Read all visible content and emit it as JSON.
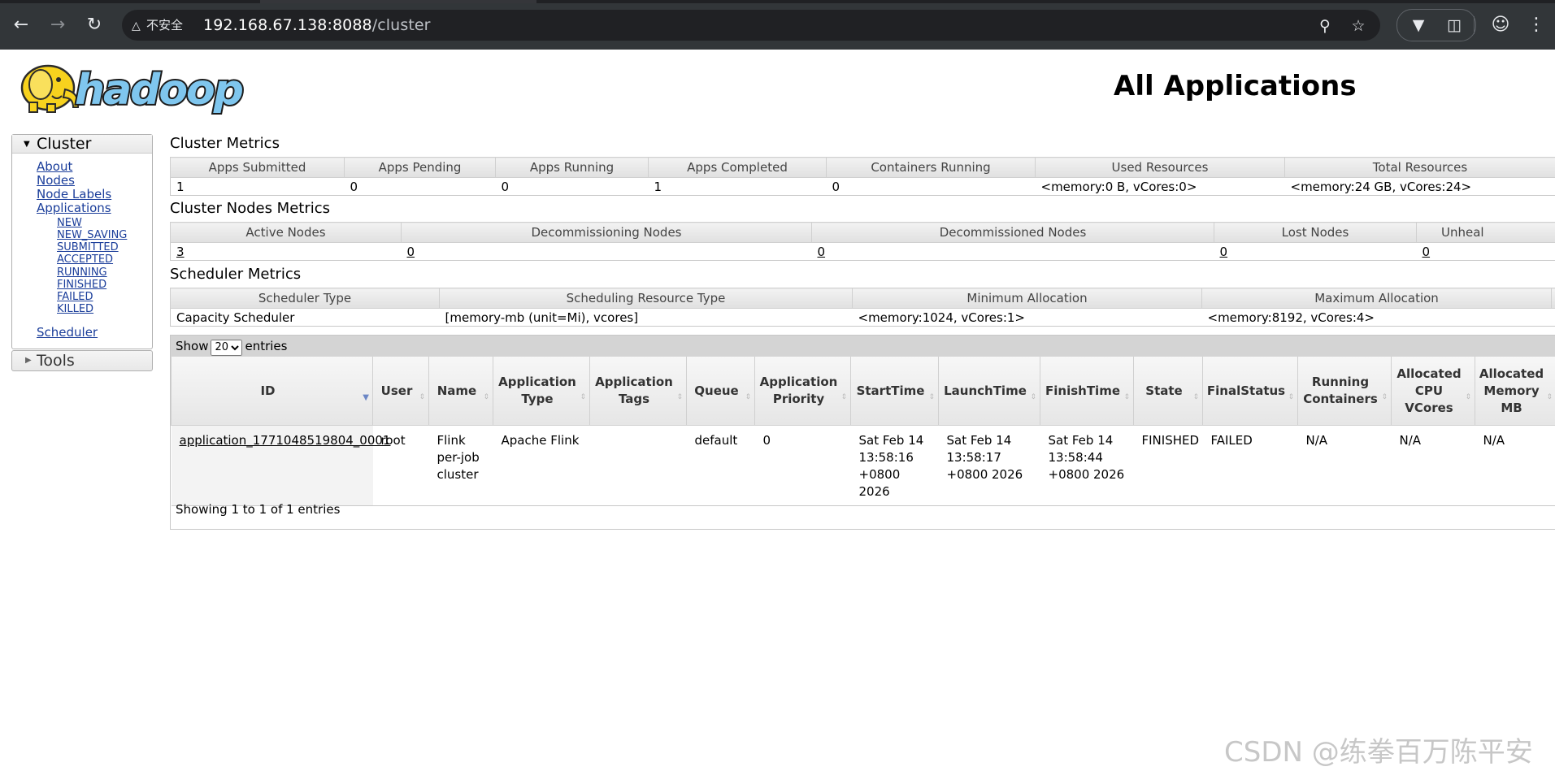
{
  "browser": {
    "security_label": "不安全",
    "url_host": "192.168.67.138:8088",
    "url_path": "/cluster",
    "icons": [
      "back-icon",
      "forward-icon",
      "reload-icon",
      "zoom-icon",
      "star-icon",
      "vpn-icon",
      "extensions-icon",
      "profile-icon",
      "menu-icon"
    ]
  },
  "header": {
    "logo_text": "hadoop",
    "title": "All Applications"
  },
  "sidebar": {
    "cluster_label": "Cluster",
    "links": [
      "About",
      "Nodes",
      "Node Labels",
      "Applications"
    ],
    "app_states": [
      "NEW",
      "NEW_SAVING",
      "SUBMITTED",
      "ACCEPTED",
      "RUNNING",
      "FINISHED",
      "FAILED",
      "KILLED"
    ],
    "scheduler_label": "Scheduler",
    "tools_label": "Tools"
  },
  "cluster_metrics": {
    "title": "Cluster Metrics",
    "headers": [
      "Apps Submitted",
      "Apps Pending",
      "Apps Running",
      "Apps Completed",
      "Containers Running",
      "Used Resources",
      "Total Resources"
    ],
    "values": [
      "1",
      "0",
      "0",
      "1",
      "0",
      "<memory:0 B, vCores:0>",
      "<memory:24 GB, vCores:24>"
    ]
  },
  "cluster_nodes_metrics": {
    "title": "Cluster Nodes Metrics",
    "headers": [
      "Active Nodes",
      "Decommissioning Nodes",
      "Decommissioned Nodes",
      "Lost Nodes",
      "Unheal"
    ],
    "values": [
      "3",
      "0",
      "0",
      "0",
      "0"
    ]
  },
  "scheduler_metrics": {
    "title": "Scheduler Metrics",
    "headers": [
      "Scheduler Type",
      "Scheduling Resource Type",
      "Minimum Allocation",
      "Maximum Allocation"
    ],
    "values": [
      "Capacity Scheduler",
      "[memory-mb (unit=Mi), vcores]",
      "<memory:1024, vCores:1>",
      "<memory:8192, vCores:4>"
    ]
  },
  "apps_table": {
    "show_label": "Show",
    "entries_label": "entries",
    "page_size": "20",
    "headers": [
      "ID",
      "User",
      "Name",
      "Application Type",
      "Application Tags",
      "Queue",
      "Application Priority",
      "StartTime",
      "LaunchTime",
      "FinishTime",
      "State",
      "FinalStatus",
      "Running Containers",
      "Allocated CPU VCores",
      "Allocated Memory MB"
    ],
    "rows": [
      [
        "application_1771048519804_0001",
        "root",
        "Flink per-job cluster",
        "Apache Flink",
        "",
        "default",
        "0",
        "Sat Feb 14 13:58:16 +0800 2026",
        "Sat Feb 14 13:58:17 +0800 2026",
        "Sat Feb 14 13:58:44 +0800 2026",
        "FINISHED",
        "FAILED",
        "N/A",
        "N/A",
        "N/A"
      ]
    ],
    "footer": "Showing 1 to 1 of 1 entries"
  },
  "watermark": "CSDN @练拳百万陈平安"
}
